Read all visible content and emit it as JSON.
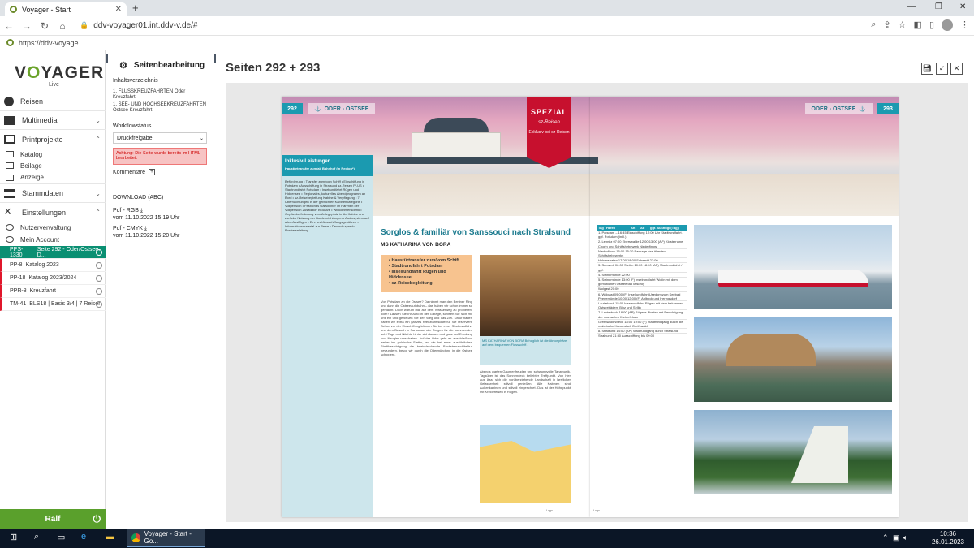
{
  "browser": {
    "tab_title": "Voyager - Start",
    "url": "ddv-voyager01.int.ddv-v.de/#",
    "bookmark": "https://ddv-voyage..."
  },
  "sidebar": {
    "logo": "VOYAGER",
    "logo_sub": "Live",
    "items": [
      {
        "label": "Reisen"
      },
      {
        "label": "Multimedia"
      },
      {
        "label": "Printprojekte"
      }
    ],
    "print_sub": [
      "Katalog",
      "Beilage",
      "Anzeige"
    ],
    "items2": [
      {
        "label": "Stammdaten"
      },
      {
        "label": "Einstellungen"
      }
    ],
    "settings_sub": [
      "Nutzerverwaltung",
      "Mein Account"
    ],
    "projects": [
      {
        "code": "PPS-1330",
        "label": "Seite 292 - Oder/Ostsee: D..."
      },
      {
        "code": "PP-8",
        "label": "Katalog 2023"
      },
      {
        "code": "PP-18",
        "label": "Katalog 2023/2024"
      },
      {
        "code": "PPR-8",
        "label": "Kreuzfahrt"
      },
      {
        "code": "TM-41",
        "label": "BLS18 | Basis 3/4 | 7 Reisen"
      }
    ],
    "user": "Ralf"
  },
  "edit_panel": {
    "title": "Seitenbearbeitung",
    "toc_label": "Inhaltsverzeichnis",
    "toc": [
      "1. FLUSSKREUZFAHRTEN Oder Kreuzfahrt",
      "1. SEE- UND HOCHSEEKREUZFAHRTEN Ostsee Kreuzfahrt"
    ],
    "workflow_label": "Workflowstatus",
    "workflow_value": "Druckfreigabe",
    "warning": "Achtung: Die Seite wurde bereits im HTML bearbeitet.",
    "comments_label": "Kommentare",
    "download_label": "DOWNLOAD (ABC)",
    "pdf_rgb": "Pdf - RGB",
    "pdf_rgb_date": "vom 11.10.2022 15:19 Uhr",
    "pdf_cmyk": "Pdf - CMYK",
    "pdf_cmyk_date": "vom 11.10.2022 15:20 Uhr"
  },
  "main": {
    "title": "Seiten 292 + 293"
  },
  "spread": {
    "left_num": "292",
    "right_num": "293",
    "region": "ODER - OSTSEE",
    "spezial": "SPEZIAL",
    "spezial_brand": "sz-Reisen",
    "spezial_sub": "Exklusiv bei sz-Reisen",
    "info_head": "Inklusiv-Leistungen",
    "info_sub": "Haustürtransfer zum/ab Bahnhof (in Region*)",
    "info_text": "Beförderung • Transfer zum/vom Schiff • Einschiffung in Potsdam • Ausschiffung in Stralsund sz-Reisen PLUS • Stadtrundfahrt Potsdam • Inselrundfahrt Rügen und Hiddensee • Regionales, kulturelles Abendprogramm an Bord • sz-Reisebegleitung Kabine & Verpflegung • 7 Übernachtungen in der gebuchten Kabinenkategorie • Vollpension • Festliches Galadinner im Rahmen der Vollpension Zusätzlich inklusive • Willkommensdrink • Gepäckbeförderung vom Anlegeplatz in die Kabine und zurück • Nutzung der Bordeinrichtungen • Audiosystem auf allen Ausflügen • Ein- und Ausschiffungsgebühren • Informationsmaterial zur Reise • Deutsch sprech. Bordreiseleitung",
    "article_title": "Sorglos & familiär von Sanssouci nach Stralsund",
    "article_sub": "MS KATHARINA VON BORA",
    "highlights": [
      "Haustürtransfer zum/vom Schiff",
      "Stadtrundfahrt Potsdam",
      "Inselrundfahrt Rügen und Hiddensee",
      "sz-Reisebegleitung"
    ],
    "cabin_caption": "MS KATHARINA VON BORA Behaglich ist die Atmosphäre auf dem bequemen Flussschiff.",
    "col1": "Von Potsdam an die Ostsee? Da nimmt man den Berliner Ring und dann die Ostseeautobahn – das haben wir schon immer so gemacht. Doch warum mal auf dem Wasserweg zu probieren, oder? Lassen Sie Ihr Auto in der Garage, schiffen Sie sich mit uns ein und genießen Sie den Weg und das Ziel. Dafür haben haben wir extra ein ganzes Kreuzfahrtschiff für Sie reserviert. Schon vor der Einschiffung können Sie bei einer Stadtrundfahrt und dem Besuch in Sanssouci alle Sorgen für die kommenden acht Tage und Nächte hinter sich lassen und ganz auf Erholung und Neugier umschalten. Auf der Oder geht es anschließend weiter ins polnische Stettin, wo wir bei einer ausführlichen Stadtbesichtigung die beeindruckende Backsteinarchitektur bewundern, bevor wir durch die Odermündung in die Ostsee schippern.",
    "col2": "Abends warten Gaumenfreuden und schwungvolle Tanzmusik. Tagsüber ist das Sonnendeck beliebter Treffpunkt. Von hier aus lässt sich die vorüberziehende Landschaft in herrlicher Gelassenheit stilvoll genießen. Alle Kabinen sind Außenkabinen und stilvoll eingerichtet. Das ist der Höhepunkt mit Kreidefelsen in Rügen.",
    "schedule_headers": [
      "Tag",
      "Hafen",
      "An",
      "Ab",
      "ggf. Ausflüge(Tag)"
    ],
    "schedule": [
      "1. Potsdam – 16:45 Einschiffung 15:00 Uhr Stadtrundfahrt / ggf. Potsdam (inkl.)",
      "2. Lehnitz 07:00 Eberswalde 12:00 13:00 (AP) Klosterruine Chorin und Schiffshebewerk Niederfinow",
      "Niederfinow 15:00 15:30 Passage des ältesten Schiffshebewerks",
      "Hohensaaten 17:00 18:00 Schwedt 22:00",
      "3. Schwedt 06:00 Stettin 10:00 18:00 (AP) Stadtrundfahrt / ggf.",
      "4. Swinemünde 22:00",
      "5. Swinemünde 13:00 (F) Inselrundfahrt Wollin mit dem gemütlichen Ostseebad Misdroy",
      "Wolgast 20:00",
      "6. Wolgast 09:00 (F) Inselrundfahrt Usedom zum Seebad Peenemünde 10:00 12:00 (F) Ahlbeck und Heringsdorf",
      "Lauterbach 15:00 Inselrundfahrt Rügen mit dem bekannten Ostseebädern Binz und Sellin",
      "7. Lauterbach 18:00 (AP) Rügens Norden mit Besichtigung der markanten Kreidefelsen",
      "Greifswald-Wieck 18:00 19:00 (F) Stadtrundgang durch die malerische Hansestadt Greifswald",
      "8. Stralsund 14:00 (AP) Stadtrundgang durch Stralsund",
      "Stralsund 21:30 Ausschiffung bis 09:00"
    ],
    "logo_text": "Logo"
  },
  "taskbar": {
    "chrome_label": "Voyager - Start - Go...",
    "time": "10:36",
    "date": "26.01.2023"
  }
}
